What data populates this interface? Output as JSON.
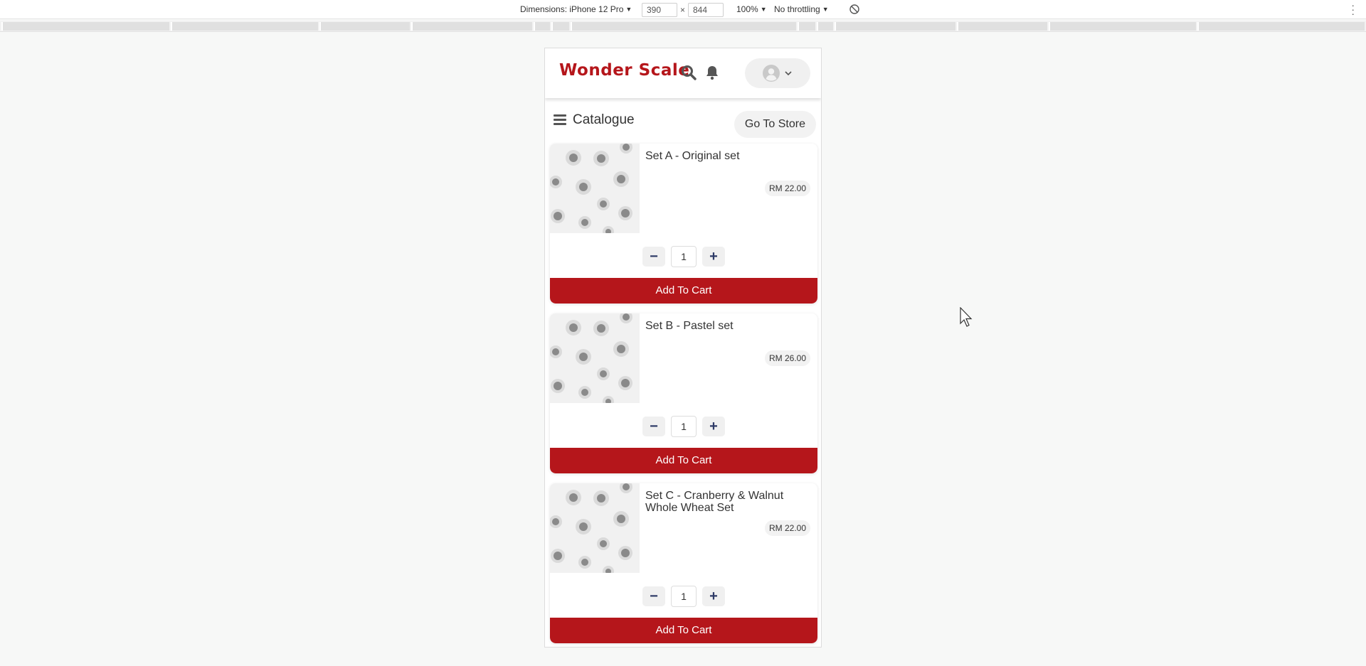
{
  "devtools": {
    "dimensions_label": "Dimensions: iPhone 12 Pro",
    "width_value": "390",
    "times": "×",
    "height_value": "844",
    "zoom": "100%",
    "throttling": "No throttling",
    "menu_icon": "more-vertical-icon",
    "rotate_icon": "rotate-icon"
  },
  "header": {
    "logo": "Wonder Scale",
    "search_icon": "search-icon",
    "bell_icon": "bell-icon",
    "avatar_icon": "user-avatar-icon"
  },
  "subheader": {
    "title": "Catalogue",
    "store_button": "Go To Store"
  },
  "products": [
    {
      "name": "Set A - Original set",
      "price": "RM 22.00",
      "quantity": "1",
      "cart_label": "Add To Cart"
    },
    {
      "name": "Set B - Pastel set",
      "price": "RM 26.00",
      "quantity": "1",
      "cart_label": "Add To Cart"
    },
    {
      "name": "Set C - Cranberry & Walnut Whole Wheat Set",
      "price": "RM 22.00",
      "quantity": "1",
      "cart_label": "Add To Cart"
    }
  ],
  "quantity_controls": {
    "minus": "−",
    "plus": "+"
  },
  "colors": {
    "brand_red": "#b5161b",
    "page_bg": "#f7f8f7"
  }
}
